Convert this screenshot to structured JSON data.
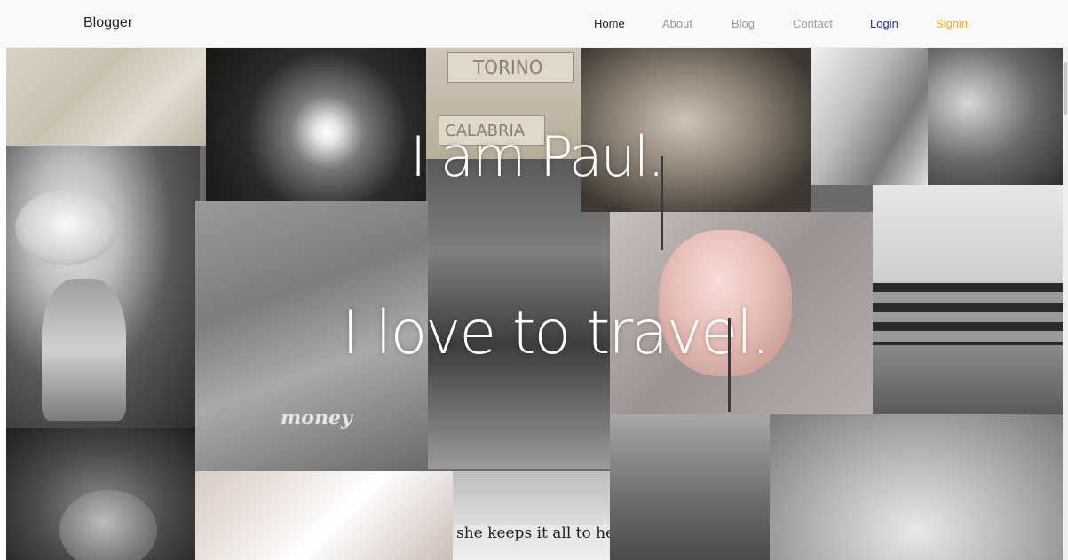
{
  "nav": {
    "brand": "Blogger",
    "links": {
      "home": "Home",
      "about": "About",
      "blog": "Blog",
      "contact": "Contact",
      "login": "Login",
      "signin": "Signin"
    },
    "colors": {
      "active": "#222222",
      "muted": "#9a9a9a",
      "login": "#2a2f8f",
      "signin": "#f0ad1a"
    }
  },
  "hero": {
    "line1": "I am Paul.",
    "line2": "I love to travel.",
    "signs": {
      "sign1": "TORINO",
      "sign2": "CALABRIA"
    },
    "collage_text": {
      "money": "money",
      "quote": "she keeps it all to herself."
    }
  }
}
